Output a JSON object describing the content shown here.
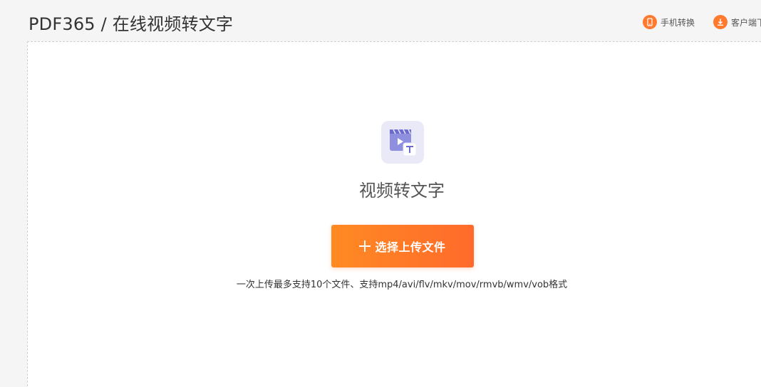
{
  "header": {
    "title": "PDF365 / 在线视频转文字",
    "actions": [
      {
        "label": "手机转换",
        "icon": "phone-icon"
      },
      {
        "label": "客户端下",
        "icon": "download-icon"
      }
    ]
  },
  "main": {
    "icon": "video-to-text-icon",
    "tool_title": "视频转文字",
    "upload_button_label": "选择上传文件",
    "hint": "一次上传最多支持10个文件、支持mp4/avi/flv/mkv/mov/rmvb/wmv/vob格式"
  },
  "colors": {
    "accent": "#ff7a2e",
    "button_start": "#ff8a22",
    "button_end": "#ff6a2c",
    "icon_bg": "#e9e9f8",
    "icon_fg": "#8f8fe0"
  }
}
